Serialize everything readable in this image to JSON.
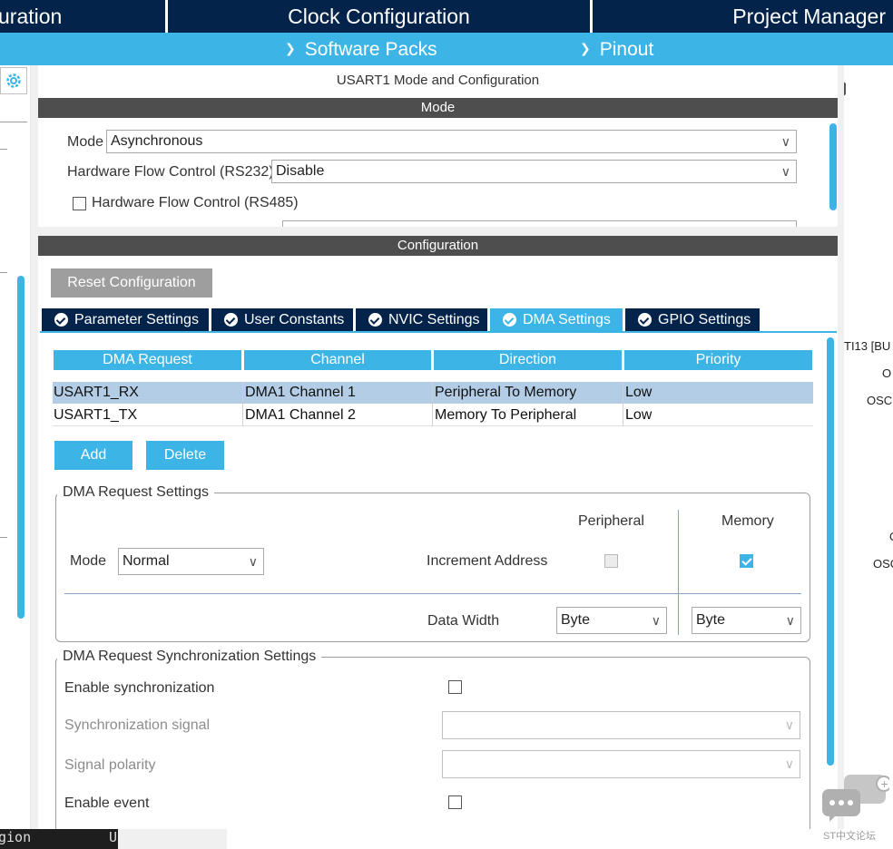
{
  "top_tabs": {
    "pinout_config": "uration",
    "clock_config": "Clock Configuration",
    "project_manager": "Project Manager"
  },
  "sub_bar": {
    "software_packs": "Software Packs",
    "pinout": "Pinout"
  },
  "panel": {
    "title": "USART1 Mode and Configuration",
    "mode_header": "Mode",
    "mode": {
      "mode_label": "Mode",
      "mode_value": "Asynchronous",
      "hw_flow_label": "Hardware Flow Control (RS232)",
      "hw_flow_value": "Disable",
      "rs485_label": "Hardware Flow Control (RS485)"
    },
    "config_header": "Configuration",
    "reset_label": "Reset Configuration"
  },
  "tabs": [
    {
      "label": "Parameter Settings"
    },
    {
      "label": "User Constants"
    },
    {
      "label": "NVIC Settings"
    },
    {
      "label": "DMA Settings"
    },
    {
      "label": "GPIO Settings"
    }
  ],
  "dma_table": {
    "headers": [
      "DMA Request",
      "Channel",
      "Direction",
      "Priority"
    ],
    "rows": [
      [
        "USART1_RX",
        "DMA1 Channel 1",
        "Peripheral To Memory",
        "Low"
      ],
      [
        "USART1_TX",
        "DMA1 Channel 2",
        "Memory To Peripheral",
        "Low"
      ]
    ],
    "selected_row": 0
  },
  "buttons": {
    "add": "Add",
    "delete": "Delete"
  },
  "dma_request_settings": {
    "title": "DMA Request Settings",
    "peripheral": "Peripheral",
    "memory": "Memory",
    "mode_label": "Mode",
    "mode_value": "Normal",
    "increment_address": "Increment Address",
    "peripheral_increment": false,
    "memory_increment": true,
    "data_width": "Data Width",
    "peripheral_width": "Byte",
    "memory_width": "Byte"
  },
  "sync_settings": {
    "title": "DMA Request Synchronization Settings",
    "enable_sync": "Enable synchronization",
    "sync_signal": "Synchronization signal",
    "signal_polarity": "Signal polarity",
    "enable_event": "Enable event"
  },
  "right_labels": [
    "TI13 [BU",
    "O",
    "OSC",
    "O",
    "OSC"
  ],
  "console_text": "gion",
  "console_tail": "U",
  "watermark": "ST中文论坛",
  "colors": {
    "dark_navy": "#03234b",
    "accent_blue": "#3cb4e6",
    "header_gray": "#4e4e4e"
  }
}
